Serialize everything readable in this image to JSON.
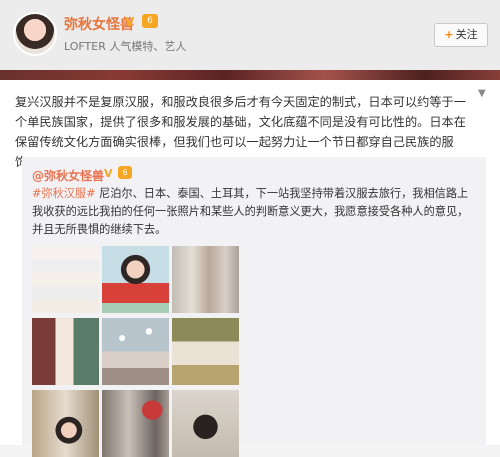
{
  "header": {
    "username": "弥秋女怪兽",
    "verified_mark": "V",
    "level_badge": "6",
    "subtitle": "LOFTER 人气模特、艺人",
    "follow_plus": "+",
    "follow_label": "关注"
  },
  "post": {
    "text": "复兴汉服并不是复原汉服，和服改良很多后才有今天固定的制式，日本可以约等于一个单民族国家，提供了很多和服发展的基础，文化底蕴不同是没有可比性的。日本在保留传统文化方面确实很棒，但我们也可以一起努力让一个节日都穿自己民族的服饰。",
    "expand_icon": "chevron-down-icon"
  },
  "repost": {
    "author": "@弥秋女怪兽",
    "verified_mark": "V",
    "level_badge": "6",
    "hashtag": "#弥秋汉服#",
    "text": " 尼泊尔、日本、泰国、土耳其，下一站我坚持带着汉服去旅行，我相信路上我收获的远比我拍的任何一张照片和某些人的判断意义更大，我愿意接受各种人的意见，并且无所畏惧的继续下去。"
  },
  "photos": [
    {
      "label": "photo-notes-screenshot"
    },
    {
      "label": "photo-red-dress-flowers"
    },
    {
      "label": "photo-street-group"
    },
    {
      "label": "photo-with-elderly-locals"
    },
    {
      "label": "photo-pigeons-square"
    },
    {
      "label": "photo-group-landscape"
    },
    {
      "label": "photo-alley-portrait"
    },
    {
      "label": "photo-street-umbrella"
    },
    {
      "label": "photo-back-portrait"
    }
  ],
  "colors": {
    "username": "#e8743b",
    "badge": "#f5a623",
    "link": "#eb7350"
  }
}
